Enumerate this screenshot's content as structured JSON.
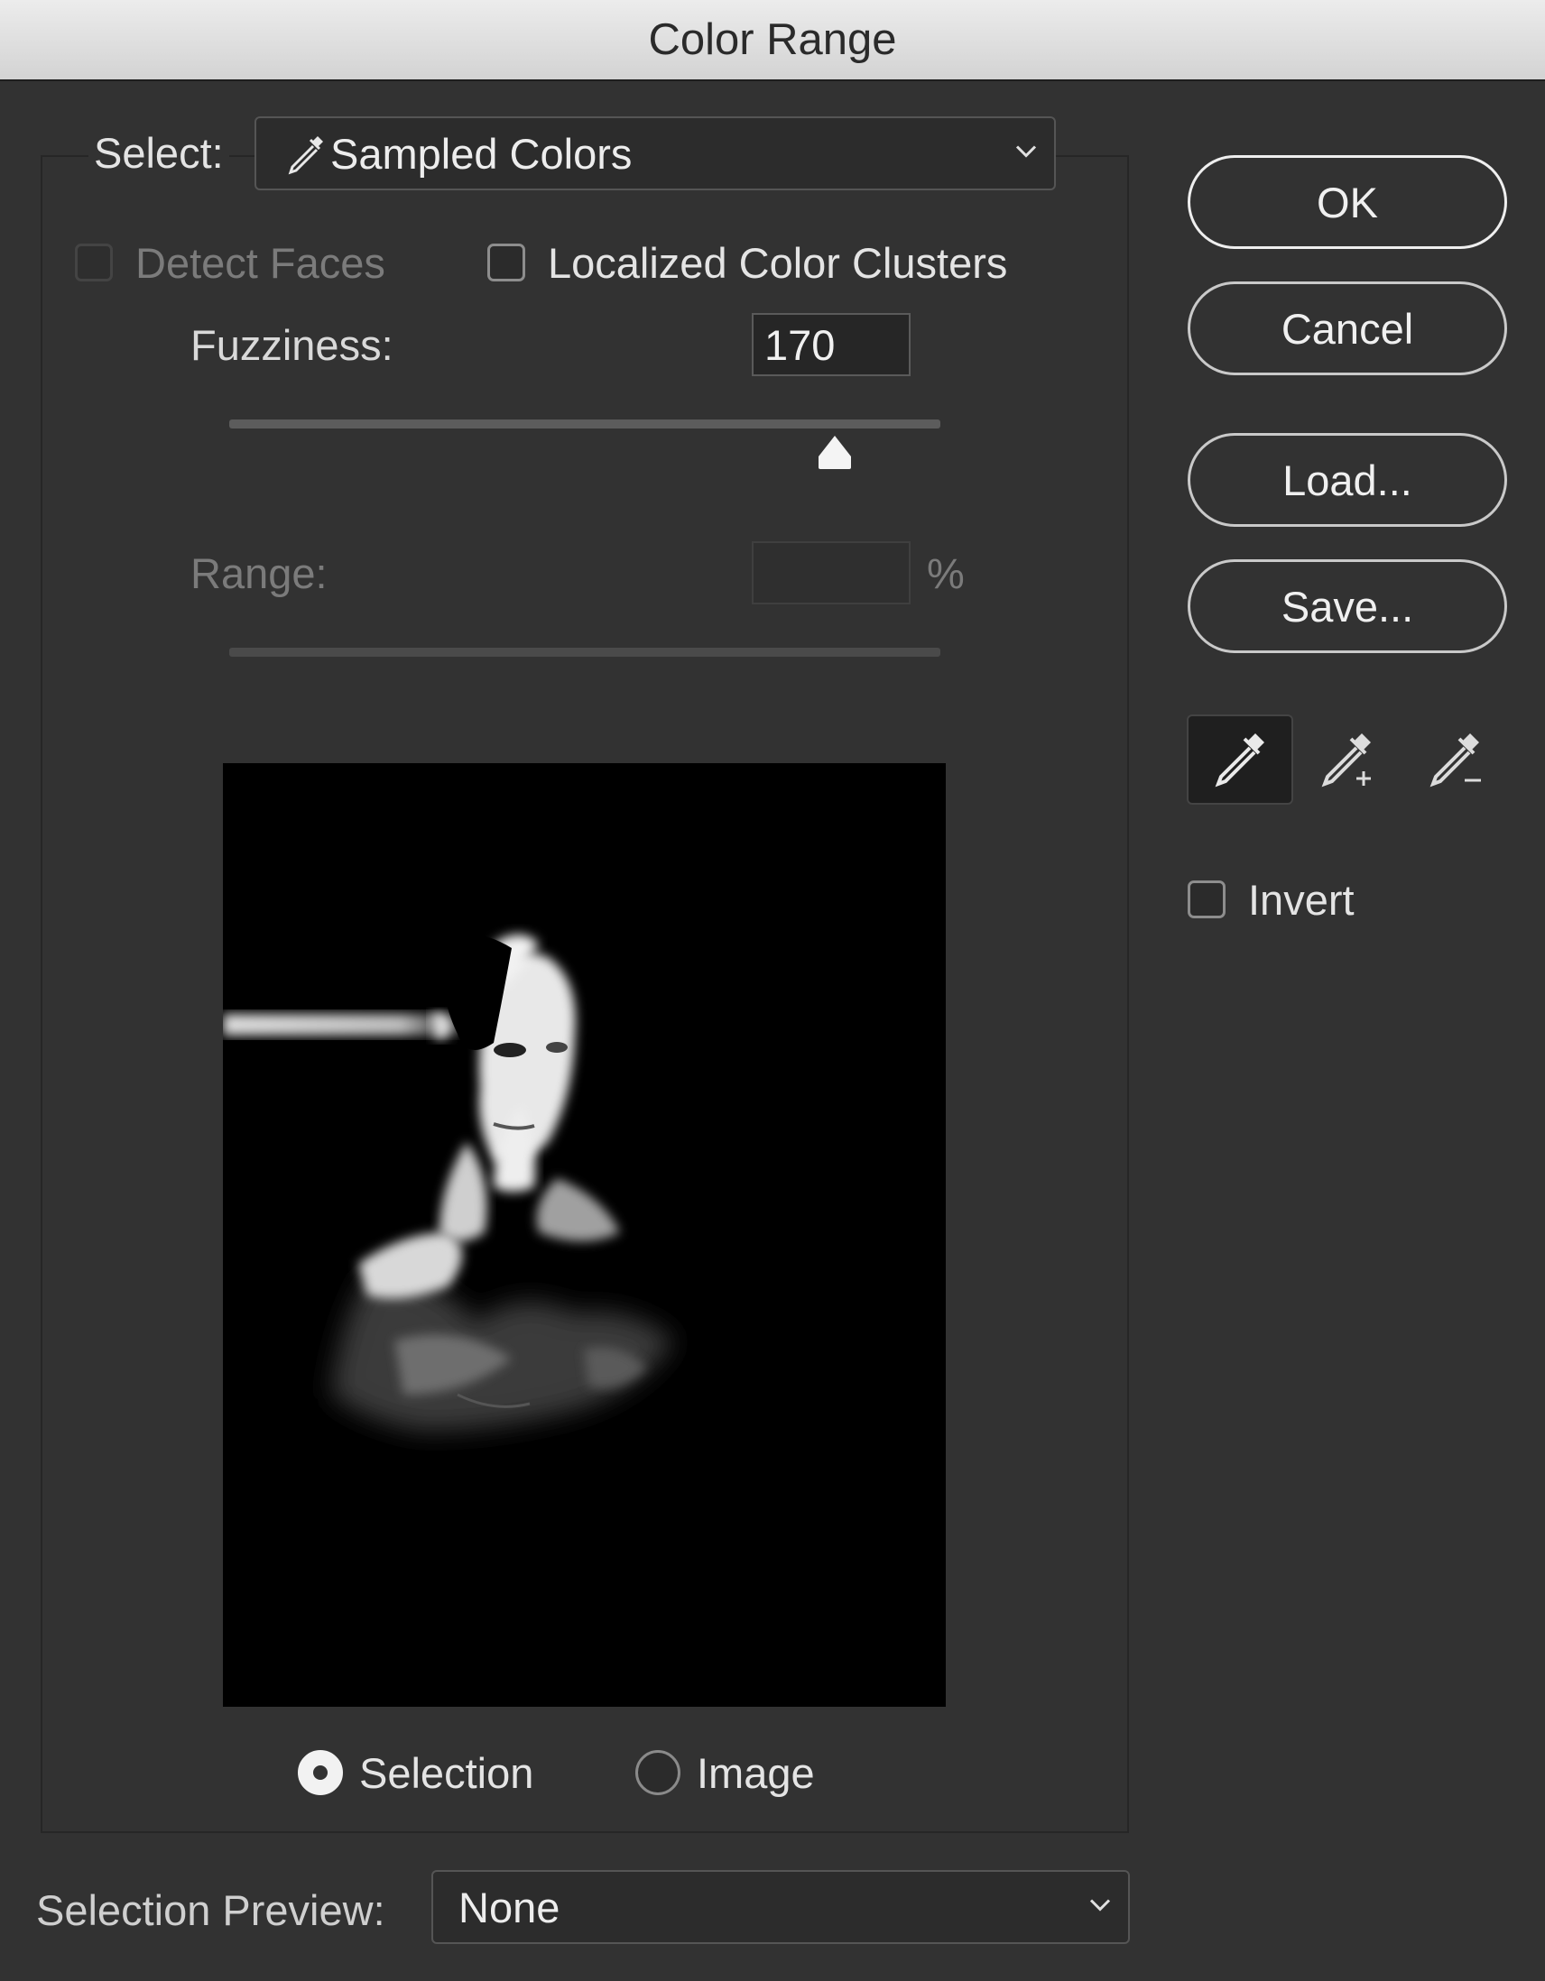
{
  "window": {
    "title": "Color Range"
  },
  "select": {
    "label": "Select:",
    "value": "Sampled Colors",
    "icon": "eyedropper-icon"
  },
  "options": {
    "detect_faces": {
      "label": "Detect Faces",
      "checked": false,
      "enabled": false
    },
    "localized_clusters": {
      "label": "Localized Color Clusters",
      "checked": false
    }
  },
  "fuzziness": {
    "label": "Fuzziness:",
    "value": "170",
    "max": 200
  },
  "range": {
    "label": "Range:",
    "value": "",
    "unit": "%",
    "enabled": false
  },
  "preview_mode": {
    "selection": {
      "label": "Selection",
      "selected": true
    },
    "image": {
      "label": "Image",
      "selected": false
    }
  },
  "selection_preview": {
    "label": "Selection Preview:",
    "value": "None"
  },
  "buttons": {
    "ok": "OK",
    "cancel": "Cancel",
    "load": "Load...",
    "save": "Save..."
  },
  "tools": [
    {
      "name": "eyedropper-icon",
      "active": true
    },
    {
      "name": "eyedropper-add-icon",
      "active": false
    },
    {
      "name": "eyedropper-subtract-icon",
      "active": false
    }
  ],
  "invert": {
    "label": "Invert",
    "checked": false
  }
}
